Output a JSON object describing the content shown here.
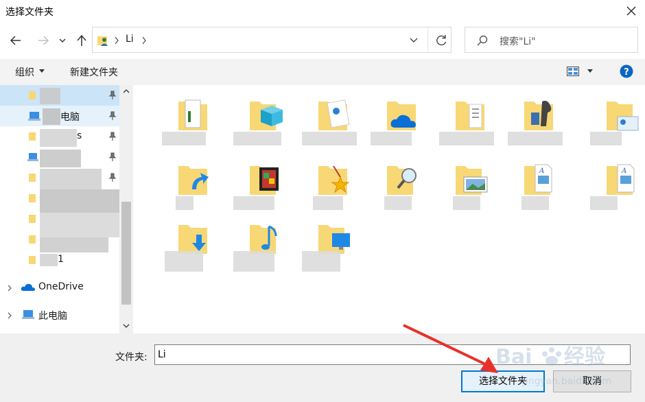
{
  "window": {
    "title": "选择文件夹"
  },
  "address": {
    "path": "Li"
  },
  "search": {
    "placeholder": "搜索\"Li\""
  },
  "toolbar": {
    "organize": "组织",
    "new_folder": "新建文件夹"
  },
  "nav": {
    "quick_items": [
      {
        "label": "电脑"
      },
      {
        "label": "s"
      },
      {
        "label": "1"
      }
    ],
    "tree": [
      {
        "label": "OneDrive"
      },
      {
        "label": "此电脑"
      }
    ]
  },
  "bottom": {
    "folder_label": "文件夹:",
    "folder_value": "Li",
    "select_button": "选择文件夹",
    "cancel_button": "取消"
  },
  "colors": {
    "accent": "#0078d7",
    "folder": "#f8d775",
    "arrow": "#e8312a"
  },
  "icons": [
    "back-icon",
    "forward-icon",
    "recent-icon",
    "up-icon",
    "user-folder-icon",
    "refresh-icon",
    "search-icon",
    "view-icon",
    "help-icon",
    "pin-icon",
    "close-icon"
  ]
}
